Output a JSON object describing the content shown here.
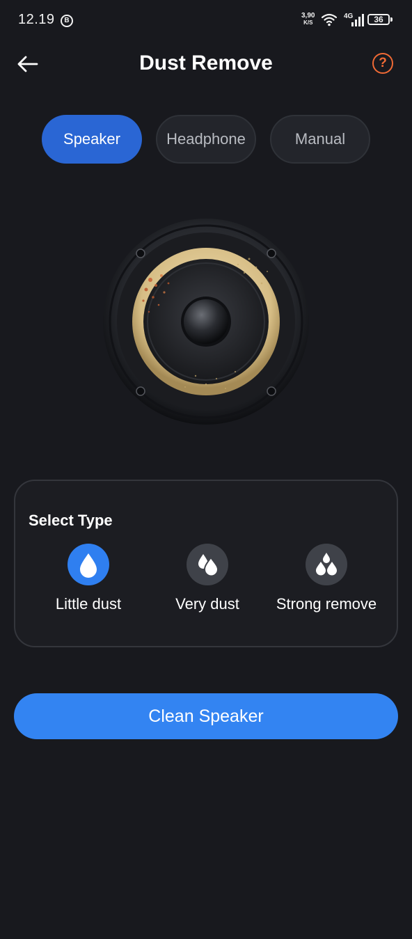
{
  "status_bar": {
    "time": "12.19",
    "b_badge": "B",
    "speed_value": "3,90",
    "speed_unit": "K/S",
    "network": "4G",
    "battery": "36"
  },
  "header": {
    "title": "Dust Remove",
    "back_icon": "arrow-left-icon",
    "help_icon": "question-circle-icon",
    "help_symbol": "?",
    "help_color": "#f06a35"
  },
  "tabs": [
    {
      "label": "Speaker",
      "active": true
    },
    {
      "label": "Headphone",
      "active": false
    },
    {
      "label": "Manual",
      "active": false
    }
  ],
  "select_type": {
    "title": "Select Type",
    "options": [
      {
        "label": "Little dust",
        "icon": "single-drop-icon",
        "selected": true
      },
      {
        "label": "Very dust",
        "icon": "double-drop-icon",
        "selected": false
      },
      {
        "label": "Strong remove",
        "icon": "triple-drop-icon",
        "selected": false
      }
    ]
  },
  "action": {
    "label": "Clean Speaker"
  },
  "colors": {
    "background": "#18191e",
    "accent": "#3384f2",
    "tab_active": "#2a66d4"
  }
}
